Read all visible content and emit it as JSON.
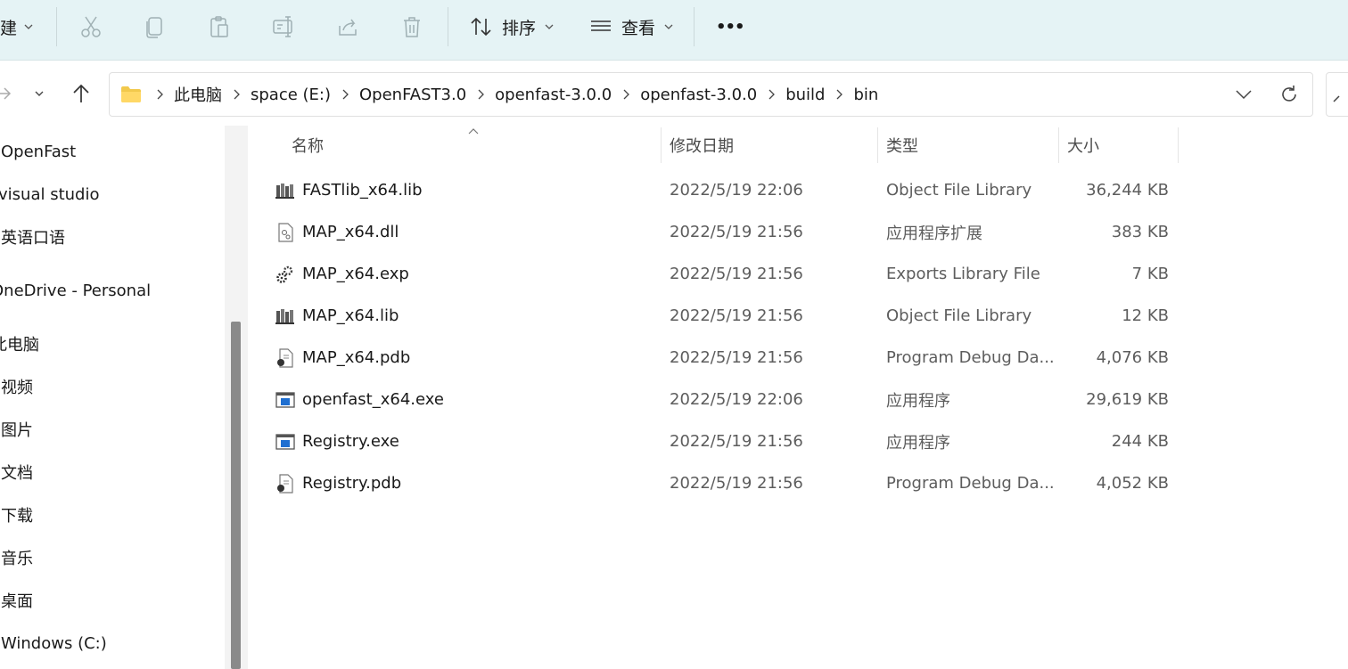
{
  "toolbar": {
    "new_label": "建",
    "sort_label": "排序",
    "view_label": "查看",
    "more_label": "•••"
  },
  "breadcrumb": [
    "此电脑",
    "space (E:)",
    "OpenFAST3.0",
    "openfast-3.0.0",
    "openfast-3.0.0",
    "build",
    "bin"
  ],
  "sidebar": {
    "items": [
      {
        "label": "OpenFast"
      },
      {
        "label": "visual studio"
      },
      {
        "label": "英语口语"
      },
      {
        "label": "OneDrive - Personal"
      },
      {
        "label": "此电脑"
      },
      {
        "label": "视频"
      },
      {
        "label": "图片"
      },
      {
        "label": "文档"
      },
      {
        "label": "下载"
      },
      {
        "label": "音乐"
      },
      {
        "label": "桌面"
      },
      {
        "label": "Windows (C:)"
      }
    ]
  },
  "columns": {
    "name": "名称",
    "date": "修改日期",
    "type": "类型",
    "size": "大小"
  },
  "files": [
    {
      "name": "FASTlib_x64.lib",
      "date": "2022/5/19 22:06",
      "type": "Object File Library",
      "size": "36,244 KB",
      "icon": "library-file-icon"
    },
    {
      "name": "MAP_x64.dll",
      "date": "2022/5/19 21:56",
      "type": "应用程序扩展",
      "size": "383 KB",
      "icon": "dll-file-icon"
    },
    {
      "name": "MAP_x64.exp",
      "date": "2022/5/19 21:56",
      "type": "Exports Library File",
      "size": "7 KB",
      "icon": "gear-file-icon"
    },
    {
      "name": "MAP_x64.lib",
      "date": "2022/5/19 21:56",
      "type": "Object File Library",
      "size": "12 KB",
      "icon": "library-file-icon"
    },
    {
      "name": "MAP_x64.pdb",
      "date": "2022/5/19 21:56",
      "type": "Program Debug Da...",
      "size": "4,076 KB",
      "icon": "pdb-file-icon"
    },
    {
      "name": "openfast_x64.exe",
      "date": "2022/5/19 22:06",
      "type": "应用程序",
      "size": "29,619 KB",
      "icon": "exe-file-icon"
    },
    {
      "name": "Registry.exe",
      "date": "2022/5/19 21:56",
      "type": "应用程序",
      "size": "244 KB",
      "icon": "exe-file-icon"
    },
    {
      "name": "Registry.pdb",
      "date": "2022/5/19 21:56",
      "type": "Program Debug Da...",
      "size": "4,052 KB",
      "icon": "pdb-file-icon"
    }
  ]
}
